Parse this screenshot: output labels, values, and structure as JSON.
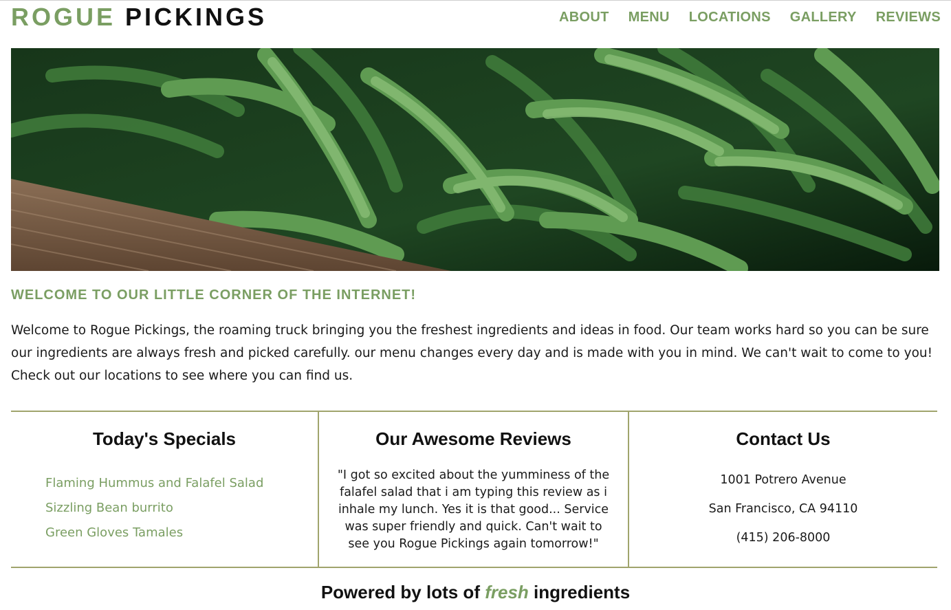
{
  "brand": {
    "part1": "ROGUE",
    "part2": "PICKINGS"
  },
  "nav": [
    "ABOUT",
    "MENU",
    "LOCATIONS",
    "GALLERY",
    "REVIEWS"
  ],
  "hero": {
    "subject": "green beans in a wooden crate"
  },
  "welcome": {
    "title": "WELCOME TO OUR LITTLE CORNER OF THE INTERNET!",
    "text": "Welcome to Rogue Pickings, the roaming truck bringing you the freshest ingredients and ideas in food. Our team works hard so you can be sure our ingredients are always fresh and picked carefully. our menu changes every day and is made with you in mind. We can't wait to come to you! Check out our locations to see where you can find us."
  },
  "specials": {
    "heading": "Today's Specials",
    "items": [
      "Flaming Hummus and Falafel Salad",
      "Sizzling Bean burrito",
      "Green Gloves Tamales"
    ]
  },
  "reviews": {
    "heading": "Our Awesome Reviews",
    "quote": "\"I got so excited about the yumminess of the falafel salad that i am typing this review as i inhale my lunch. Yes it is that good... Service was super friendly and quick. Can't wait to see you Rogue Pickings again tomorrow!\""
  },
  "contact": {
    "heading": "Contact Us",
    "address1": "1001 Potrero Avenue",
    "address2": "San Francisco, CA 94110",
    "phone": "(415) 206-8000"
  },
  "footer": {
    "before": "Powered by lots of",
    "emphasis": "fresh",
    "after": "ingredients"
  },
  "colors": {
    "accent": "#7a9e62",
    "rule": "#a0a46c",
    "text": "#1a1a1a"
  }
}
